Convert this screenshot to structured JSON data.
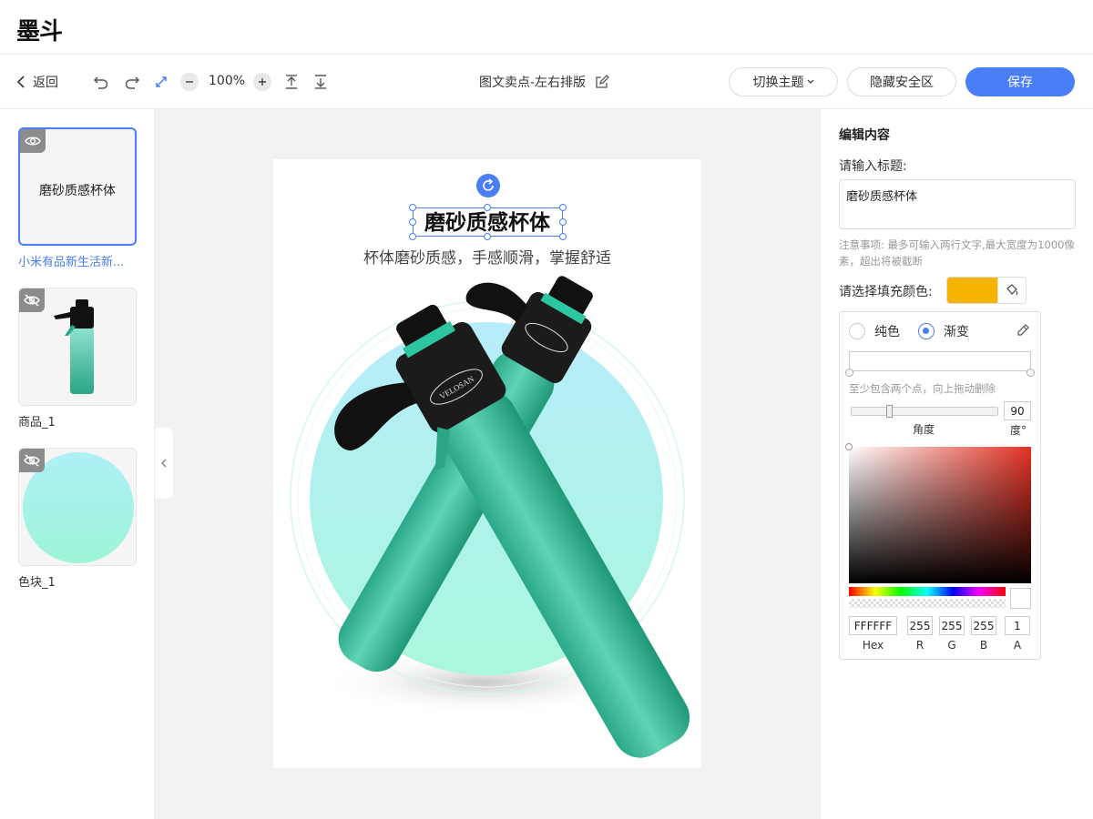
{
  "brand": {
    "logo": "墨斗"
  },
  "toolbar": {
    "back_label": "返回",
    "zoom": "100%",
    "doc_title": "图文卖点-左右排版",
    "theme_label": "切换主题",
    "safe_area_label": "隐藏安全区",
    "save_label": "保存"
  },
  "layers": [
    {
      "thumb_text": "磨砂质感杯体",
      "name": "小米有品新生活新...",
      "selected": true,
      "visible": true
    },
    {
      "name": "商品_1",
      "selected": false,
      "visible": false
    },
    {
      "name": "色块_1",
      "selected": false,
      "visible": false
    }
  ],
  "canvas": {
    "title": "磨砂质感杯体",
    "subtitle": "杯体磨砂质感，手感顺滑，掌握舒适",
    "product_brand_text": "VELOSAN"
  },
  "editor": {
    "heading": "编辑内容",
    "title_label": "请输入标题:",
    "title_value": "磨砂质感杯体",
    "note": "注意事项: 最多可输入两行文字,最大宽度为1000像素，超出将被截断",
    "fill_label": "请选择填充颜色:",
    "fill_color": "#f5b400"
  },
  "picker": {
    "solid_label": "纯色",
    "gradient_label": "渐变",
    "mode": "gradient",
    "hint": "至少包含两个点，向上拖动删除",
    "angle_value": "90",
    "angle_label": "角度",
    "degree_label": "度°",
    "hex": "FFFFFF",
    "r": "255",
    "g": "255",
    "b": "255",
    "a": "1",
    "hex_label": "Hex",
    "r_label": "R",
    "g_label": "G",
    "b_label": "B",
    "a_label": "A",
    "hue_color": "#e53224"
  }
}
